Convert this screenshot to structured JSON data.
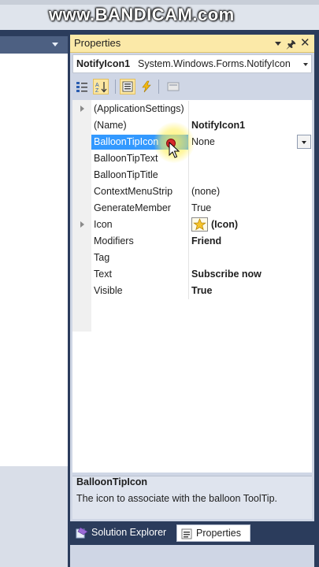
{
  "watermark": "www.BANDICAM.com",
  "panel": {
    "title": "Properties",
    "object_name": "NotifyIcon1",
    "object_type": "System.Windows.Forms.NotifyIcon"
  },
  "toolbar": {
    "buttons": [
      "categorized-icon",
      "alphabetical-icon",
      "properties-icon",
      "events-icon",
      "property-pages-icon"
    ]
  },
  "properties": [
    {
      "name": "(ApplicationSettings)",
      "value": "",
      "expandable": true
    },
    {
      "name": "(Name)",
      "value": "NotifyIcon1",
      "bold": true
    },
    {
      "name": "BalloonTipIcon",
      "value": "None",
      "selected": true
    },
    {
      "name": "BalloonTipText",
      "value": ""
    },
    {
      "name": "BalloonTipTitle",
      "value": ""
    },
    {
      "name": "ContextMenuStrip",
      "value": "(none)"
    },
    {
      "name": "GenerateMember",
      "value": "True"
    },
    {
      "name": "Icon",
      "value": "(Icon)",
      "bold": true,
      "expandable": true
    },
    {
      "name": "Modifiers",
      "value": "Friend",
      "bold": true
    },
    {
      "name": "Tag",
      "value": ""
    },
    {
      "name": "Text",
      "value": "Subscribe now",
      "bold": true
    },
    {
      "name": "Visible",
      "value": "True",
      "bold": true
    }
  ],
  "description": {
    "title": "BalloonTipIcon",
    "text": "The icon to associate with the balloon ToolTip."
  },
  "tabs": [
    {
      "label": "Solution Explorer",
      "active": false
    },
    {
      "label": "Properties",
      "active": true
    }
  ],
  "colors": {
    "selection": "#3399ff",
    "title_bar": "#fbe9a8",
    "background": "#2b3c5c"
  }
}
